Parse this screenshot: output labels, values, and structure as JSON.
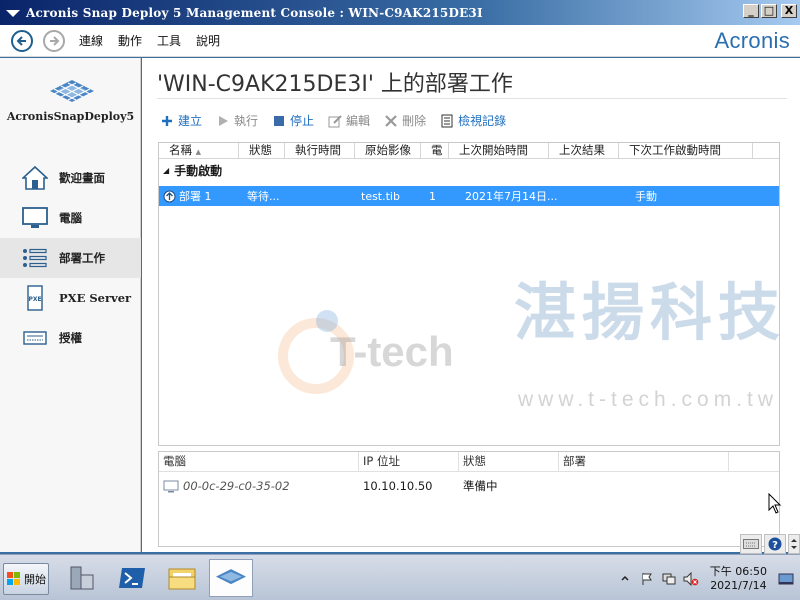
{
  "window": {
    "title": "Acronis Snap Deploy 5 Management Console : WIN-C9AK215DE3I",
    "buttons": [
      "_",
      "□",
      "X"
    ]
  },
  "menubar": {
    "items": [
      "連線",
      "動作",
      "工具",
      "說明"
    ],
    "brand": "Acronis"
  },
  "sidebar": {
    "product_name": "AcronisSnapDeploy5",
    "items": [
      {
        "label": "歡迎畫面",
        "icon": "home-icon",
        "active": false
      },
      {
        "label": "電腦",
        "icon": "monitor-icon",
        "active": false
      },
      {
        "label": "部署工作",
        "icon": "task-list-icon",
        "active": true
      },
      {
        "label": "PXE Server",
        "icon": "pxe-server-icon",
        "active": false
      },
      {
        "label": "授權",
        "icon": "license-icon",
        "active": false
      }
    ]
  },
  "main": {
    "heading": "'WIN-C9AK215DE3I' 上的部署工作",
    "toolbar": [
      {
        "label": "建立",
        "icon": "plus-icon",
        "enabled": true
      },
      {
        "label": "執行",
        "icon": "play-icon",
        "enabled": false
      },
      {
        "label": "停止",
        "icon": "stop-icon",
        "enabled": true
      },
      {
        "label": "編輯",
        "icon": "edit-icon",
        "enabled": false
      },
      {
        "label": "刪除",
        "icon": "delete-icon",
        "enabled": false
      },
      {
        "label": "檢視記錄",
        "icon": "log-icon",
        "enabled": true
      }
    ],
    "columns": [
      "名稱",
      "狀態",
      "執行時間",
      "原始影像",
      "電",
      "上次開始時間",
      "上次結果",
      "下次工作啟動時間"
    ],
    "group_label": "手動啟動",
    "rows": [
      {
        "name": "部署 1",
        "status": "等待...",
        "run_time": "",
        "image": "test.tib",
        "count": "1",
        "last_start": "2021年7月14日...",
        "last_result": "",
        "next_start": "手動"
      }
    ],
    "watermark": {
      "cn": "湛揚科技",
      "brand": "T-tech",
      "url": "www.t-tech.com.tw"
    },
    "bottom_columns": [
      "電腦",
      "IP 位址",
      "狀態",
      "部署"
    ],
    "bottom_rows": [
      {
        "computer": "00-0c-29-c0-35-02",
        "ip": "10.10.10.50",
        "status": "準備中",
        "deploy": ""
      }
    ]
  },
  "taskbar": {
    "start_label": "開始",
    "clock_time": "下午 06:50",
    "clock_date": "2021/7/14"
  }
}
